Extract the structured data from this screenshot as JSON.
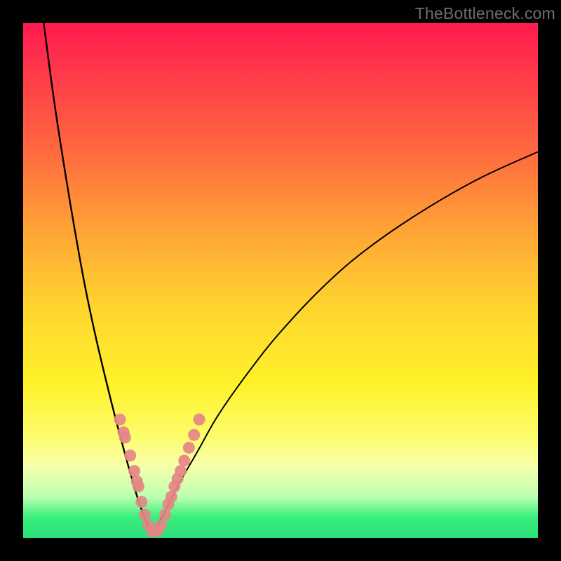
{
  "watermark": "TheBottleneck.com",
  "chart_data": {
    "type": "line",
    "title": "",
    "xlabel": "",
    "ylabel": "",
    "xlim": [
      0,
      100
    ],
    "ylim": [
      0,
      100
    ],
    "series": [
      {
        "name": "left-curve",
        "x": [
          4,
          6,
          8,
          10,
          12,
          14,
          16,
          18,
          20,
          21,
          22,
          23,
          24,
          25
        ],
        "y": [
          100,
          85,
          72,
          60,
          49,
          39.5,
          31,
          23,
          15.5,
          12,
          8.5,
          5.5,
          3,
          1
        ]
      },
      {
        "name": "right-curve",
        "x": [
          25,
          27,
          30,
          34,
          38,
          44,
          50,
          58,
          66,
          76,
          88,
          100
        ],
        "y": [
          1,
          4,
          10,
          17,
          24,
          32.5,
          40,
          48.5,
          55.5,
          62.5,
          69.5,
          75
        ]
      }
    ],
    "highlight_points": {
      "name": "dots",
      "x": [
        18.8,
        19.5,
        19.8,
        20.8,
        21.6,
        22.1,
        22.4,
        23.0,
        23.6,
        24.3,
        25.0,
        26.0,
        26.8,
        27.6,
        28.2,
        28.8,
        29.4,
        30.0,
        30.6,
        31.3,
        32.2,
        33.2,
        34.2
      ],
      "y": [
        23.0,
        20.5,
        19.5,
        16.0,
        13.0,
        11.0,
        10.0,
        7.0,
        4.5,
        2.5,
        1.3,
        1.3,
        2.5,
        4.5,
        6.5,
        8.0,
        10.0,
        11.5,
        13.0,
        15.0,
        17.5,
        20.0,
        23.0
      ]
    },
    "background_gradient": {
      "top": "#ff1a4f",
      "bottom": "#2be07a"
    }
  }
}
